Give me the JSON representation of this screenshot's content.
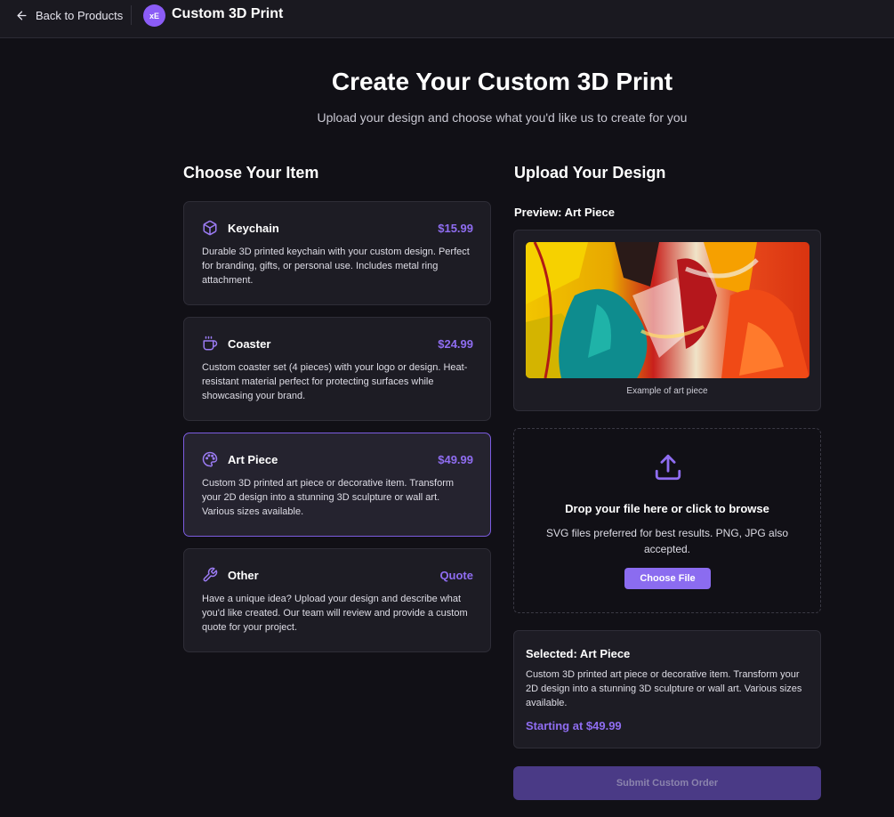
{
  "topbar": {
    "back_label": "Back to Products",
    "brand_badge": "xE",
    "brand_title": "Custom 3D Print"
  },
  "hero": {
    "title": "Create Your Custom 3D Print",
    "subtitle": "Upload your design and choose what you'd like us to create for you"
  },
  "items_section": {
    "heading": "Choose Your Item",
    "items": [
      {
        "name": "Keychain",
        "price": "$15.99",
        "icon": "cube-icon",
        "desc": "Durable 3D printed keychain with your custom design. Perfect for branding, gifts, or personal use. Includes metal ring attachment.",
        "selected": false
      },
      {
        "name": "Coaster",
        "price": "$24.99",
        "icon": "cup-icon",
        "desc": "Custom coaster set (4 pieces) with your logo or design. Heat-resistant material perfect for protecting surfaces while showcasing your brand.",
        "selected": false
      },
      {
        "name": "Art Piece",
        "price": "$49.99",
        "icon": "palette-icon",
        "desc": "Custom 3D printed art piece or decorative item. Transform your 2D design into a stunning 3D sculpture or wall art. Various sizes available.",
        "selected": true
      },
      {
        "name": "Other",
        "price": "Quote",
        "icon": "wrench-icon",
        "desc": "Have a unique idea? Upload your design and describe what you'd like created. Our team will review and provide a custom quote for your project.",
        "selected": false
      }
    ]
  },
  "upload_section": {
    "heading": "Upload Your Design",
    "preview_label": "Preview: Art Piece",
    "preview_caption": "Example of art piece",
    "drop_title": "Drop your file here or click to browse",
    "drop_hint": "SVG files preferred for best results. PNG, JPG also accepted.",
    "choose_file_label": "Choose File"
  },
  "summary": {
    "title": "Selected: Art Piece",
    "desc": "Custom 3D printed art piece or decorative item. Transform your 2D design into a stunning 3D sculpture or wall art. Various sizes available.",
    "price": "Starting at $49.99"
  },
  "submit_label": "Submit Custom Order",
  "colors": {
    "accent": "#8b6cf0",
    "background": "#111016",
    "card": "#1d1c24",
    "submit_disabled": "#4a3a86"
  }
}
